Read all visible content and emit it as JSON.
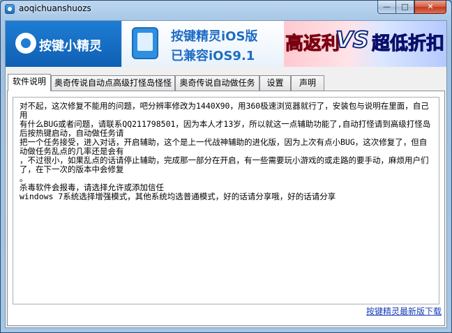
{
  "window": {
    "title": "aoqichuanshuozs",
    "controls": {
      "minimize": "—",
      "maximize": "□",
      "close": "✕"
    }
  },
  "banner": {
    "logo_text": "按键小精灵",
    "ad1_line1": "按键精灵iOS版",
    "ad1_line2": "已兼容iOS9.1",
    "ad2_left": "高返利",
    "ad2_vs": "VS",
    "ad2_right": "超低折扣"
  },
  "tabs": [
    {
      "label": "软件说明",
      "active": true
    },
    {
      "label": "奥奇传说自动点高级打怪岛怪怪",
      "active": false
    },
    {
      "label": "奥奇传说自动做任务",
      "active": false
    },
    {
      "label": "设置",
      "active": false
    },
    {
      "label": "声明",
      "active": false
    }
  ],
  "content": {
    "lines": [
      "对不起，这次修复不能用的问题，吧分辨率修改为1440X90，用360极速浏览器就行了，安装包与说明在里面，自己用",
      "有什么BUG或者问题，请联系QQ211798501，因为本人才13岁，所以就这一点辅助功能了,自动打怪请到高级打怪岛后按热键启动，自动做任务请",
      "把一个任务接受，进入对话，开启辅助，这个是上一代战神辅助的进化版，因为上次有点小BUG，这次修复了，但自动做任务乱点的几率还是会有",
      "，不过很小，如果乱点的话请停止辅助，完成那一部分在开启，有一些需要玩小游戏的或走路的要手动，麻烦用户们了，在下一次的版本中会修复",
      "。",
      "杀毒软件会报毒，请选择允许或添加信任",
      "windows 7系统选择增强模式，其他系统均选普通模式，好的话请分享哦，好的话请分享"
    ]
  },
  "footer_link": "按键精灵最新版下载",
  "colors": {
    "link": "#1a3fb8",
    "ad_red": "#e3122b",
    "ad_blue": "#1d2fd8",
    "brand_blue": "#1e7dd4"
  }
}
